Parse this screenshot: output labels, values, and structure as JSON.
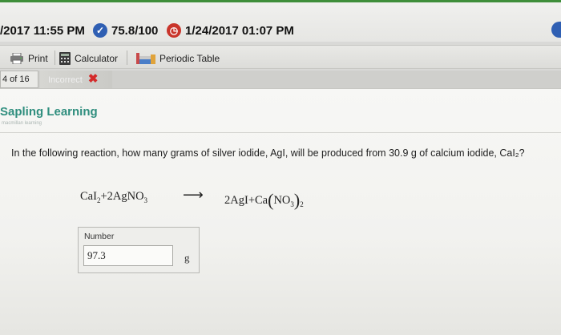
{
  "status": {
    "submitted_time": "/2017 11:55 PM",
    "score": "75.8/100",
    "due_time": "1/24/2017 01:07 PM"
  },
  "toolbar": {
    "print_label": "Print",
    "calculator_label": "Calculator",
    "periodic_table_label": "Periodic Table"
  },
  "tabs": {
    "counter": "4 of 16",
    "status": "Incorrect"
  },
  "brand": {
    "name": "Sapling Learning",
    "tagline": "macmillan learning"
  },
  "question": {
    "text": "In the following reaction, how many grams of silver iodide, AgI, will be produced from 30.9 g of calcium iodide, CaI₂?"
  },
  "reaction": {
    "reactant1": "CaI",
    "reactant1_sub": "2",
    "reactant2": "2AgNO",
    "reactant2_sub": "3",
    "arrow": "⟶",
    "product1": "2AgI",
    "product2": "Ca",
    "product2_inner": "NO",
    "product2_inner_sub": "3",
    "product2_sub": "2"
  },
  "answer": {
    "label": "Number",
    "value": "97.3",
    "unit": "g"
  },
  "colors": {
    "brand": "#2f8e7e",
    "accent_green": "#3e8e3a",
    "score_icon": "#2f5fb3",
    "due_icon": "#c9352b",
    "incorrect_x": "#d42a2a"
  }
}
